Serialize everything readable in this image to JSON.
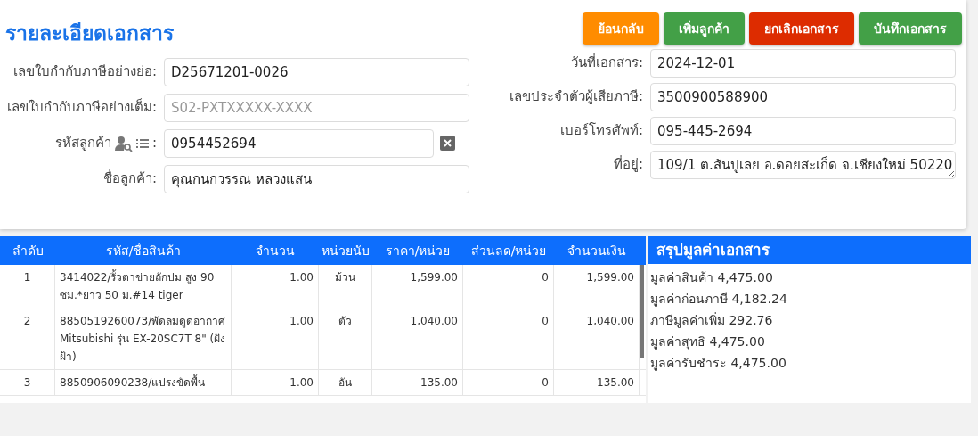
{
  "title": "รายละเอียดเอกสาร",
  "buttons": [
    {
      "label": "ย้อนกลับ",
      "kind": "back"
    },
    {
      "label": "เพิ่มลูกค้า",
      "kind": "add"
    },
    {
      "label": "ยกเลิกเอกสาร",
      "kind": "cancel"
    },
    {
      "label": "บันทึกเอกสาร",
      "kind": "save"
    }
  ],
  "left_fields": [
    {
      "label": "เลขใบกำกับภาษีอย่างย่อ:",
      "value": "D25671201-0026"
    },
    {
      "label": "เลขใบกำกับภาษีอย่างเต็ม:",
      "placeholder": "S02-PXTXXXXX-XXXX"
    },
    {
      "label": "รหัสลูกค้า",
      "value": "0954452694",
      "kind": "lookup"
    },
    {
      "label": "ชื่อลูกค้า:",
      "value": "คุณกนกวรรณ หลวงแสน"
    }
  ],
  "lookup_colon": ":",
  "right_fields": [
    {
      "label": "วันที่เอกสาร:",
      "value": "2024-12-01"
    },
    {
      "label": "เลขประจำตัวผู้เสียภาษี:",
      "value": "3500900588900"
    },
    {
      "label": "เบอร์โทรศัพท์:",
      "value": "095-445-2694"
    },
    {
      "label": "ที่อยู่:",
      "value": "109/1 ต.สันปูเลย อ.ดอยสะเก็ด จ.เชียงใหม่ 50220",
      "kind": "textarea"
    }
  ],
  "table": {
    "columns": [
      "ลำดับ",
      "รหัส/ชื่อสินค้า",
      "จำนวน",
      "หน่วยนับ",
      "ราคา/หน่วย",
      "ส่วนลด/หน่วย",
      "จำนวนเงิน"
    ],
    "rows": [
      [
        "1",
        "3414022/รั้วตาข่ายถักปม สูง 90 ซม.*ยาว 50 ม.#14 tiger",
        "1.00",
        "ม้วน",
        "1,599.00",
        "0",
        "1,599.00"
      ],
      [
        "2",
        "8850519260073/พัดลมดูดอากาศ Mitsubishi รุ่น EX-20SC7T 8\" (ฝังฝ้า)",
        "1.00",
        "ตัว",
        "1,040.00",
        "0",
        "1,040.00"
      ],
      [
        "3",
        "8850906090238/แปรงขัดพื้น",
        "1.00",
        "อัน",
        "135.00",
        "0",
        "135.00"
      ]
    ]
  },
  "summary": {
    "title": "สรุปมูลค่าเอกสาร",
    "lines": [
      "มูลค่าสินค้า 4,475.00",
      "มูลค่าก่อนภาษี 4,182.24",
      "ภาษีมูลค่าเพิ่ม 292.76",
      "มูลค่าสุทธิ 4,475.00",
      "มูลค่ารับชำระ 4,475.00"
    ]
  }
}
